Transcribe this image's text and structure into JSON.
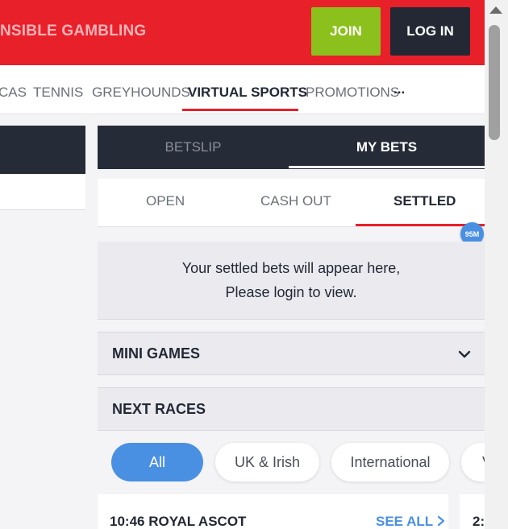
{
  "header": {
    "responsible_gambling": "NSIBLE GAMBLING",
    "join_label": "JOIN",
    "login_label": "LOG IN"
  },
  "nav": {
    "items": [
      {
        "label": "CAS"
      },
      {
        "label": "TENNIS"
      },
      {
        "label": "GREYHOUNDS"
      },
      {
        "label": "VIRTUAL SPORTS",
        "active": true
      },
      {
        "label": "PROMOTIONS"
      },
      {
        "label": "..."
      }
    ]
  },
  "betslip": {
    "tabs": [
      {
        "label": "BETSLIP"
      },
      {
        "label": "MY BETS",
        "active": true
      }
    ],
    "sub_tabs": [
      {
        "label": "OPEN"
      },
      {
        "label": "CASH OUT"
      },
      {
        "label": "SETTLED",
        "active": true
      }
    ],
    "badge": "95M",
    "message_line1": "Your settled bets will appear here,",
    "message_line2": "Please login to view."
  },
  "sections": {
    "mini_games": "MINI GAMES",
    "next_races": "NEXT RACES"
  },
  "filters": [
    {
      "label": "All",
      "active": true
    },
    {
      "label": "UK & Irish"
    },
    {
      "label": "International"
    },
    {
      "label": "V"
    }
  ],
  "races": [
    {
      "title": "10:46 ROYAL ASCOT",
      "see_all": "SEE ALL"
    },
    {
      "title": "2:"
    }
  ],
  "colors": {
    "brand_red": "#e8202a",
    "join_green": "#8cc11d",
    "dark": "#232834",
    "accent_blue": "#4a90e2"
  }
}
